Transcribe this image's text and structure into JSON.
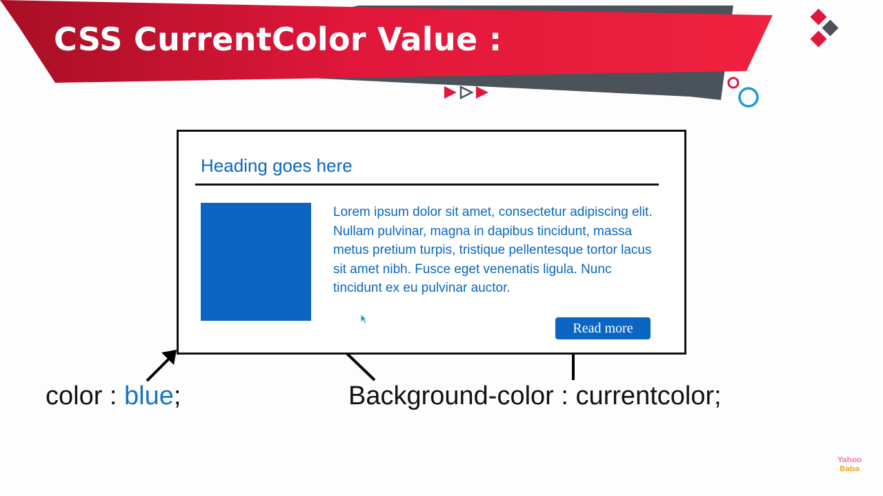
{
  "slide": {
    "title": "CSS CurrentColor Value :",
    "colors": {
      "banner_red": "#e0173a",
      "banner_dark": "#4a525a",
      "accent_blue": "#0a66c2"
    }
  },
  "card": {
    "heading": "Heading goes here",
    "paragraph": "Lorem ipsum dolor sit amet, consectetur adipiscing elit. Nullam pulvinar, magna in dapibus tincidunt, massa metus pretium turpis, tristique pellentesque tortor lacus sit amet nibh. Fusce eget venenatis ligula. Nunc tincidunt ex eu pulvinar auctor.",
    "button_label": "Read more"
  },
  "annotations": {
    "left_prefix": "color : ",
    "left_value": "blue",
    "left_suffix": ";",
    "right": "Background-color : currentcolor;"
  },
  "watermark": {
    "line1": "Yahoo",
    "line2": "Baba"
  }
}
